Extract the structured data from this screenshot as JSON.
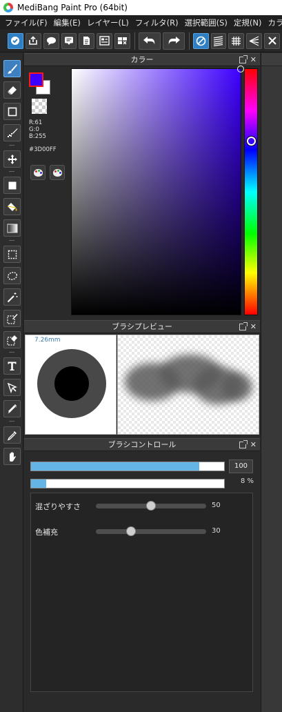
{
  "window": {
    "title": "MediBang Paint Pro (64bit)"
  },
  "menu": [
    "ファイル(F)",
    "編集(E)",
    "レイヤー(L)",
    "フィルタ(R)",
    "選択範囲(S)",
    "定規(N)",
    "カラ"
  ],
  "toolbar": {
    "buttons": [
      "check-icon",
      "share-icon",
      "speech-bubble-icon",
      "comment-icon",
      "page-icon",
      "page-list-icon",
      "page-grid-icon",
      "undo-icon",
      "redo-icon",
      "no-snap-icon",
      "parallel-snap-icon",
      "grid-snap-icon",
      "perspective-snap-icon",
      "close-icon"
    ]
  },
  "tools": [
    "brush",
    "eraser",
    "rectangle",
    "dot-brush",
    "move",
    "fill-rect",
    "bucket",
    "gradient",
    "select-rect",
    "select-lasso",
    "magic-wand",
    "select-pen",
    "select-eraser",
    "text",
    "operation",
    "divide",
    "eyedropper",
    "hand"
  ],
  "color_panel": {
    "title": "カラー",
    "foreground_color": "#3D00FF",
    "background_color": "#FFFFFF",
    "r": "R:61",
    "g": "G:0",
    "b": "B:255",
    "hex": "#3D00FF",
    "hue_color": "#3D00FF"
  },
  "preview_panel": {
    "title": "ブラシプレビュー",
    "size": "7.26mm"
  },
  "control_panel": {
    "title": "ブラシコントロール",
    "size_value": "100",
    "size_fraction": 0.87,
    "opacity_pct": "8 %",
    "opacity_fraction": 0.08,
    "sliders": [
      {
        "label": "混ざりやすさ",
        "value": "50",
        "fraction": 0.5
      },
      {
        "label": "色補充",
        "value": "30",
        "fraction": 0.32
      }
    ]
  },
  "colors": {
    "accent": "#3e7fc0",
    "fill_blue": "#64b4e6",
    "panel_bg": "#2a2a2a"
  }
}
